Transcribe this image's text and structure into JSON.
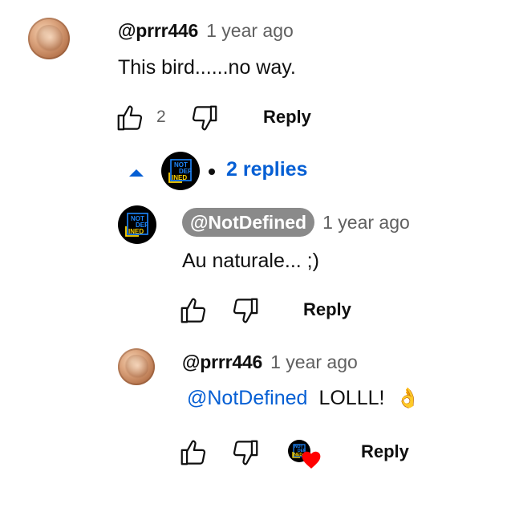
{
  "comment": {
    "handle": "@prrr446",
    "time": "1 year ago",
    "text": "This bird......no way.",
    "likes": "2",
    "reply_label": "Reply",
    "replies_toggle": {
      "avatar_text": [
        "NOT",
        "DEF",
        "INED"
      ],
      "label": "2 replies"
    }
  },
  "replies": [
    {
      "handle": "@NotDefined",
      "time": "1 year ago",
      "text": "Au naturale... ;)",
      "reply_label": "Reply",
      "avatar_text": [
        "NOT",
        "DEF",
        "INED"
      ]
    },
    {
      "handle": "@prrr446",
      "time": "1 year ago",
      "mention": "@NotDefined",
      "text": "LOLLL!",
      "emoji": "👌",
      "reply_label": "Reply",
      "creator_heart_avatar_text": [
        "NOT",
        "DEF",
        "INED"
      ]
    }
  ],
  "icons": {
    "like": "thumbs-up-icon",
    "dislike": "thumbs-down-icon",
    "collapse": "caret-up-icon",
    "heart": "heart-icon"
  },
  "colors": {
    "link_blue": "#065fd4",
    "heart_red": "#ff0000",
    "chip_gray": "#8a8a8a"
  }
}
